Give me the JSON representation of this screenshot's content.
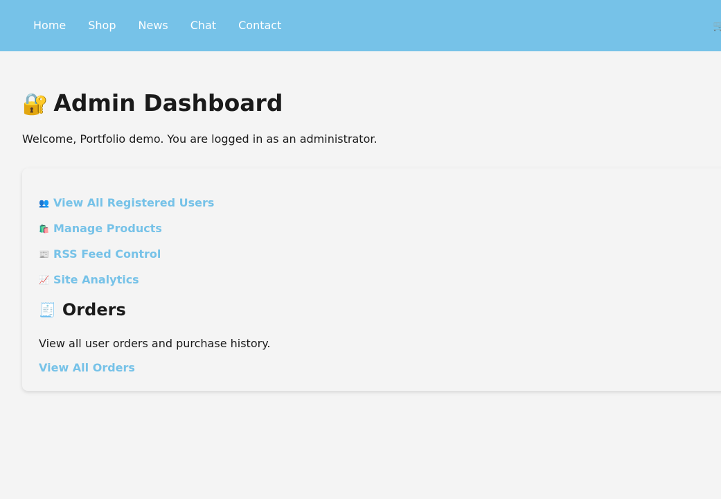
{
  "nav": {
    "links": [
      "Home",
      "Shop",
      "News",
      "Chat",
      "Contact"
    ],
    "cart_icon": "🛒"
  },
  "page": {
    "title_icon": "🔐",
    "title": "Admin Dashboard",
    "welcome": "Welcome, Portfolio demo. You are logged in as an administrator."
  },
  "admin_links": [
    {
      "icon": "👥",
      "label": "View All Registered Users"
    },
    {
      "icon": "🛍️",
      "label": "Manage Products"
    },
    {
      "icon": "📰",
      "label": "RSS Feed Control"
    },
    {
      "icon": "📈",
      "label": "Site Analytics"
    }
  ],
  "orders": {
    "icon": "🧾",
    "title": "Orders",
    "description": "View all user orders and purchase history.",
    "link_label": "View All Orders"
  },
  "colors": {
    "accent": "#76c2e8",
    "background": "#f4f4f4",
    "text": "#1a1a1a"
  }
}
